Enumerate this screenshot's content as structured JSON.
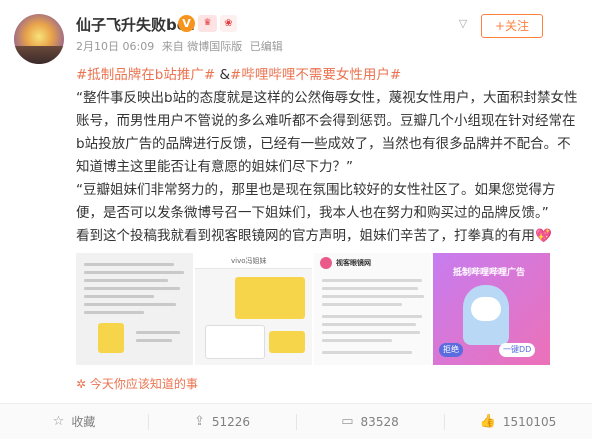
{
  "user": {
    "name": "仙子飞升失败bot",
    "badges": [
      "V",
      "vip",
      "gift"
    ]
  },
  "meta": {
    "date": "2月10日 06:09",
    "source": "来自 微博国际版",
    "edited": "已编辑"
  },
  "header": {
    "follow_label": "+关注",
    "menu_icon": "chevron-down-icon"
  },
  "post": {
    "hashtag1": "#抵制品牌在b站推广#",
    "hashtag_joiner": " &",
    "hashtag2": "#哔哩哔哩不需要女性用户#",
    "quote1": "“整件事反映出b站的态度就是这样的公然侮辱女性，蔑视女性用户，大面积封禁女性账号，而男性用户不管说的多么难听都不会得到惩罚。豆瓣几个小组现在针对经常在b站投放广告的品牌进行反馈，已经有一些成效了，当然也有很多品牌并不配合。不知道博主这里能否让有意愿的姐妹们尽下力？”",
    "quote2": "“豆瓣姐妹们非常努力的，那里也是现在氛围比较好的女性社区了。如果您觉得方便，是否可以发条微博号召一下姐妹们，我本人也在努力和购买过的品牌反馈。”",
    "closing": "看到这个投稿我就看到视客眼镜网的官方声明，姐妹们辛苦了，打拳真的有用",
    "closing_emoji": "💖"
  },
  "images": {
    "count": 4,
    "img2_header": "vivo冯姐妹",
    "img3_header": "视客眼镜网",
    "img4_title": "抵制哔哩哔哩广告",
    "img4_chip1": "拒绝",
    "img4_chip2": "一键DD"
  },
  "today_link": {
    "icon": "sun-icon",
    "text": "今天你应该知道的事"
  },
  "actions": [
    {
      "icon": "star-icon",
      "label": "收藏"
    },
    {
      "icon": "share-icon",
      "label": "51226"
    },
    {
      "icon": "comment-icon",
      "label": "83528"
    },
    {
      "icon": "like-icon",
      "label": "1510105"
    }
  ],
  "colors": {
    "accent": "#eb7350",
    "follow": "#ff8140",
    "muted": "#999999"
  }
}
